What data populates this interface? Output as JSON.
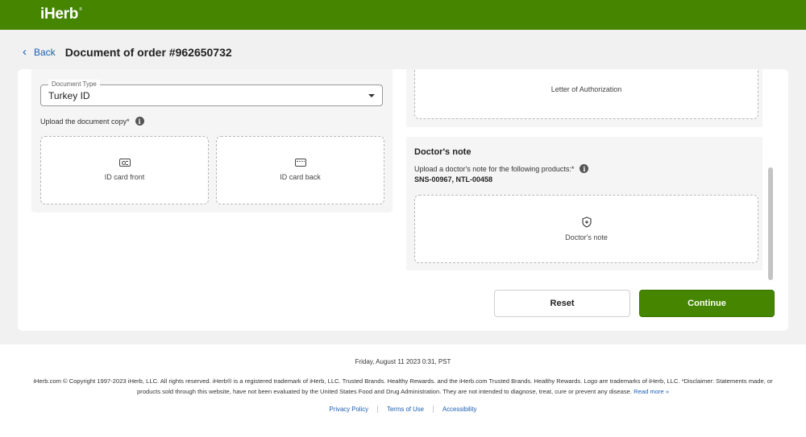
{
  "app": {
    "logo": "iHerb",
    "logo_mark": "®",
    "brand_color": "#458500"
  },
  "header": {
    "back_label": "Back",
    "title": "Document of order #962650732"
  },
  "document_type": {
    "legend": "Document Type",
    "value": "Turkey ID",
    "upload_label": "Upload the document copy*",
    "front_label": "ID card front",
    "back_label": "ID card back"
  },
  "authorization": {
    "label": "Letter of Authorization"
  },
  "doctor_note": {
    "title": "Doctor's note",
    "description": "Upload a doctor's note for the following products:*",
    "products": "SNS-00967, NTL-00458",
    "box_label": "Doctor's note"
  },
  "actions": {
    "reset": "Reset",
    "continue": "Continue"
  },
  "footer": {
    "date": "Friday, August 11 2023 0:31, PST",
    "copyright": "iHerb.com © Copyright 1997-2023 iHerb, LLC. All rights reserved. iHerb® is a registered trademark of iHerb, LLC. Trusted Brands. Healthy Rewards. and the iHerb.com Trusted Brands. Healthy Rewards. Logo are trademarks of iHerb, LLC. *Disclaimer: Statements made, or products sold through this website, have not been evaluated by the United States Food and Drug Administration. They are not intended to diagnose, treat, cure or prevent any disease.",
    "read_more": "Read more »",
    "links": [
      "Privacy Policy",
      "Terms of Use",
      "Accessibility"
    ]
  }
}
